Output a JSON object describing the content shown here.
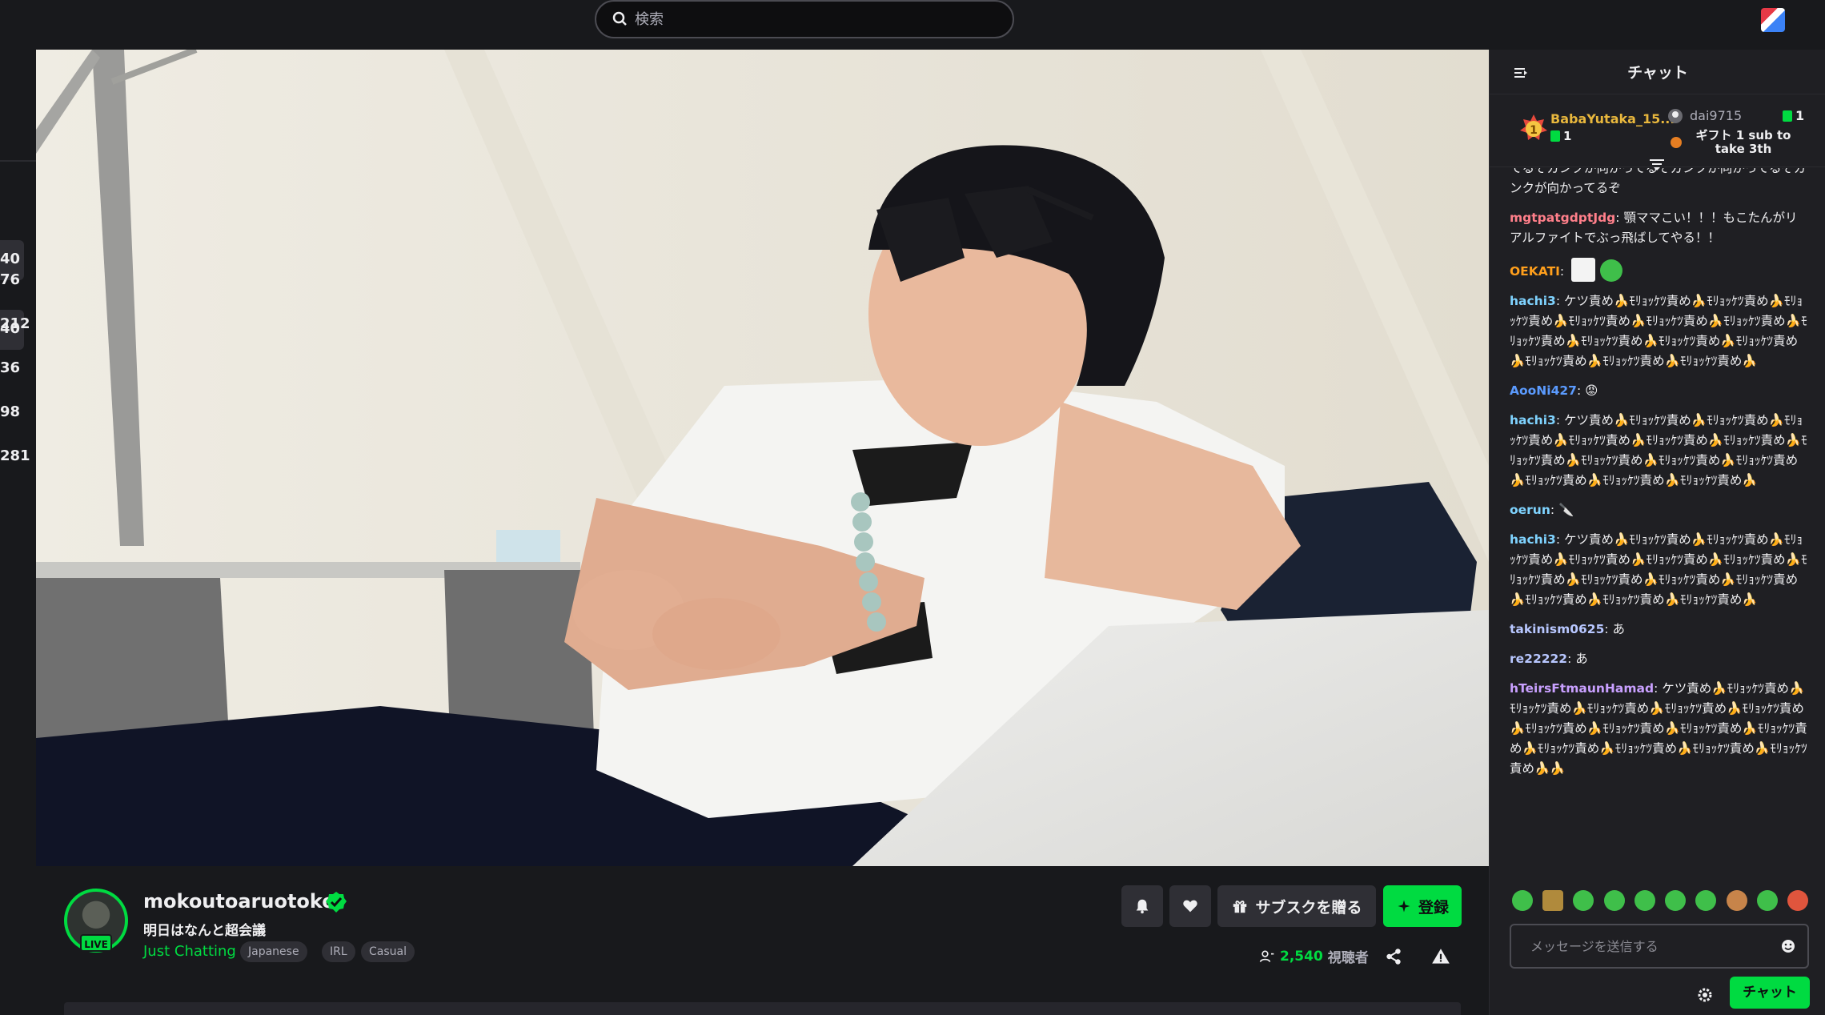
{
  "search": {
    "placeholder": "検索"
  },
  "sidebar": {
    "numbers": [
      "40",
      "40",
      "76",
      "212",
      "36",
      "98",
      "281"
    ]
  },
  "channel": {
    "name": "mokoutoaruotoko",
    "live_label": "LIVE",
    "title": "明日はなんと超会議",
    "category": "Just Chatting",
    "tags": [
      "Japanese",
      "IRL",
      "Casual"
    ]
  },
  "actions": {
    "gift_sub_label": "サブスクを贈る",
    "subscribe_label": "登録"
  },
  "viewers": {
    "count": "2,540",
    "label": "視聴者"
  },
  "chat": {
    "title": "チャット",
    "leaderboard": {
      "first": {
        "name": "BabaYutaka_15...",
        "count": "1"
      },
      "second": {
        "name": "dai9715",
        "count": "1",
        "text": "ギフト 1 sub to take 3th"
      }
    },
    "messages": [
      {
        "user": "",
        "color": "#efeff1",
        "text": "てるぞガンクが向かってるぞガンクが向かってるぞガンクが向かってるぞ"
      },
      {
        "user": "mgtpatgdptJdg",
        "color": "#ff7f8a",
        "text": "顎ママこい！！！もこたんがリアルファイトでぶっ飛ばしてやる！！"
      },
      {
        "user": "OEKATI",
        "color": "#ff9f1c",
        "text": ""
      },
      {
        "user": "hachi3",
        "color": "#7fd3ff",
        "text": "ケツ責め🍌ﾓﾘｮｯｹﾂ責め🍌ﾓﾘｮｯｹﾂ責め🍌ﾓﾘｮｯｹﾂ責め🍌ﾓﾘｮｯｹﾂ責め🍌ﾓﾘｮｯｹﾂ責め🍌ﾓﾘｮｯｹﾂ責め🍌ﾓﾘｮｯｹﾂ責め🍌ﾓﾘｮｯｹﾂ責め🍌ﾓﾘｮｯｹﾂ責め🍌ﾓﾘｮｯｹﾂ責め🍌ﾓﾘｮｯｹﾂ責め🍌ﾓﾘｮｯｹﾂ責め🍌ﾓﾘｮｯｹﾂ責め🍌"
      },
      {
        "user": "AooNi427",
        "color": "#5b9bff",
        "text": "😡"
      },
      {
        "user": "hachi3",
        "color": "#7fd3ff",
        "text": "ケツ責め🍌ﾓﾘｮｯｹﾂ責め🍌ﾓﾘｮｯｹﾂ責め🍌ﾓﾘｮｯｹﾂ責め🍌ﾓﾘｮｯｹﾂ責め🍌ﾓﾘｮｯｹﾂ責め🍌ﾓﾘｮｯｹﾂ責め🍌ﾓﾘｮｯｹﾂ責め🍌ﾓﾘｮｯｹﾂ責め🍌ﾓﾘｮｯｹﾂ責め🍌ﾓﾘｮｯｹﾂ責め🍌ﾓﾘｮｯｹﾂ責め🍌ﾓﾘｮｯｹﾂ責め🍌ﾓﾘｮｯｹﾂ責め🍌"
      },
      {
        "user": "oerun",
        "color": "#7fd3ff",
        "text": "🔪"
      },
      {
        "user": "hachi3",
        "color": "#7fd3ff",
        "text": "ケツ責め🍌ﾓﾘｮｯｹﾂ責め🍌ﾓﾘｮｯｹﾂ責め🍌ﾓﾘｮｯｹﾂ責め🍌ﾓﾘｮｯｹﾂ責め🍌ﾓﾘｮｯｹﾂ責め🍌ﾓﾘｮｯｹﾂ責め🍌ﾓﾘｮｯｹﾂ責め🍌ﾓﾘｮｯｹﾂ責め🍌ﾓﾘｮｯｹﾂ責め🍌ﾓﾘｮｯｹﾂ責め🍌ﾓﾘｮｯｹﾂ責め🍌ﾓﾘｮｯｹﾂ責め🍌ﾓﾘｮｯｹﾂ責め🍌"
      },
      {
        "user": "takinism0625",
        "color": "#b8c7ff",
        "text": "あ"
      },
      {
        "user": "re22222",
        "color": "#b8c7ff",
        "text": "あ"
      },
      {
        "user": "hTeirsFtmaunHamad",
        "color": "#c9a0ff",
        "text": "ケツ責め🍌ﾓﾘｮｯｹﾂ責め🍌ﾓﾘｮｯｹﾂ責め🍌ﾓﾘｮｯｹﾂ責め🍌ﾓﾘｮｯｹﾂ責め🍌ﾓﾘｮｯｹﾂ責め🍌ﾓﾘｮｯｹﾂ責め🍌ﾓﾘｮｯｹﾂ責め🍌ﾓﾘｮｯｹﾂ責め🍌ﾓﾘｮｯｹﾂ責め🍌ﾓﾘｮｯｹﾂ責め🍌ﾓﾘｮｯｹﾂ責め🍌ﾓﾘｮｯｹﾂ責め🍌ﾓﾘｮｯｹﾂ責め🍌🍌"
      }
    ],
    "input_placeholder": "メッセージを送信する",
    "send_label": "チャット"
  },
  "colors": {
    "accent": "#00db41",
    "background": "#18191c",
    "chat_bg": "#1f1f23"
  }
}
